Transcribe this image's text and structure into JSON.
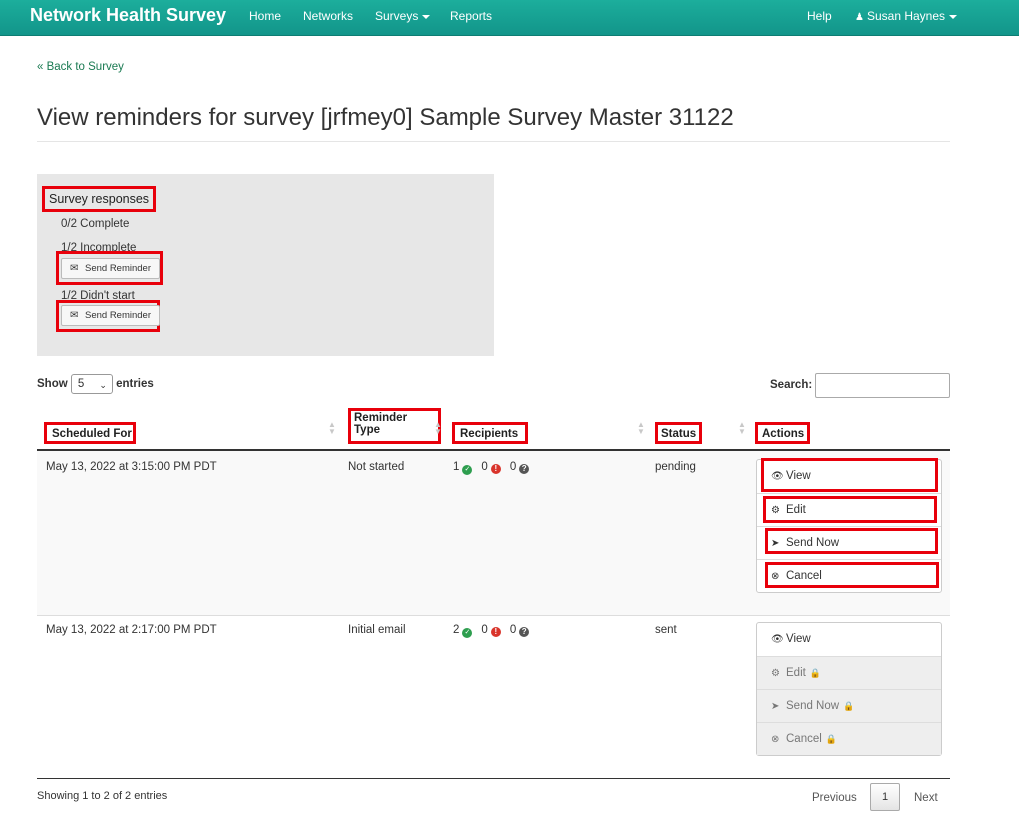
{
  "navbar": {
    "brand": "Network Health Survey",
    "links": [
      "Home",
      "Networks",
      "Surveys",
      "Reports"
    ],
    "help": "Help",
    "user": "Susan Haynes",
    "color": "#16a394"
  },
  "back_link": "« Back to Survey",
  "title": "View reminders for survey [jrfmey0] Sample Survey Master 31122",
  "responses": {
    "heading": "Survey responses",
    "complete": "0/2 Complete",
    "incomplete": "1/2 Incomplete",
    "didnt_start": "1/2 Didn't start",
    "send_reminder": "Send Reminder"
  },
  "table_controls": {
    "show": "Show",
    "entries_value": "5",
    "entries": "entries",
    "search_label": "Search:",
    "search_value": ""
  },
  "columns": {
    "scheduled_for": "Scheduled For",
    "reminder_line1": "Reminder",
    "reminder_line2": "Type",
    "recipients": "Recipients",
    "status": "Status",
    "actions": "Actions"
  },
  "rows": [
    {
      "scheduled": "May 13, 2022 at 3:15:00 PM PDT",
      "type": "Not started",
      "ok": "1",
      "err": "0",
      "unknown": "0",
      "status": "pending",
      "actions": [
        "View",
        "Edit",
        "Send Now",
        "Cancel"
      ]
    },
    {
      "scheduled": "May 13, 2022 at 2:17:00 PM PDT",
      "type": "Initial email",
      "ok": "2",
      "err": "0",
      "unknown": "0",
      "status": "sent",
      "actions": [
        "View",
        "Edit",
        "Send Now",
        "Cancel"
      ]
    }
  ],
  "footer": {
    "info": "Showing 1 to 2 of 2 entries",
    "previous": "Previous",
    "page": "1",
    "next": "Next"
  }
}
